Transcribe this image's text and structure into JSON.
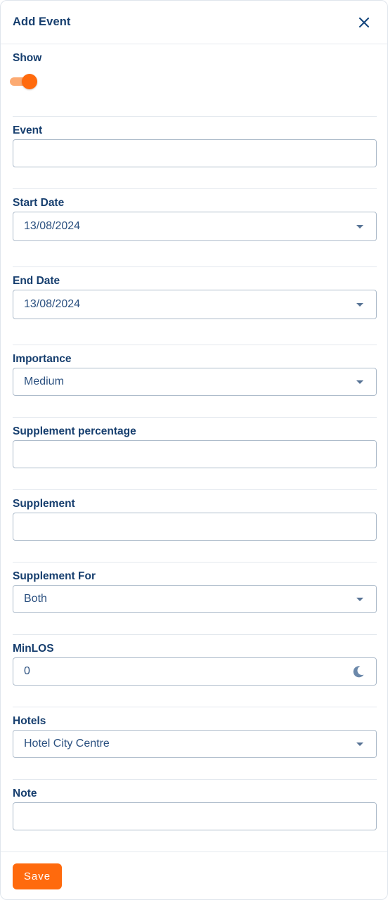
{
  "header": {
    "title": "Add Event",
    "close_icon": "close-icon"
  },
  "show": {
    "label": "Show",
    "enabled": true,
    "accent_color": "#ff6a0d"
  },
  "event": {
    "label": "Event",
    "value": ""
  },
  "start_date": {
    "label": "Start Date",
    "value": "13/08/2024"
  },
  "end_date": {
    "label": "End Date",
    "value": "13/08/2024"
  },
  "importance": {
    "label": "Importance",
    "value": "Medium"
  },
  "supplement_percentage": {
    "label": "Supplement percentage",
    "value": ""
  },
  "supplement": {
    "label": "Supplement",
    "value": ""
  },
  "supplement_for": {
    "label": "Supplement For",
    "value": "Both"
  },
  "minlos": {
    "label": "MinLOS",
    "value": "0",
    "icon": "moon-icon"
  },
  "hotels": {
    "label": "Hotels",
    "value": "Hotel City Centre"
  },
  "note": {
    "label": "Note",
    "value": ""
  },
  "footer": {
    "save_label": "Save"
  }
}
